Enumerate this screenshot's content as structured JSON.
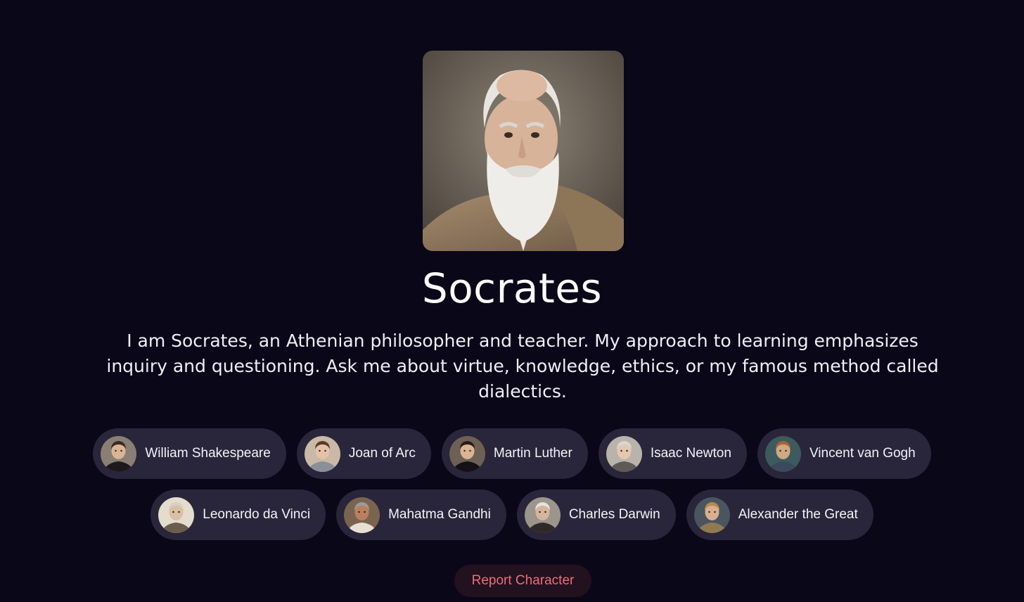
{
  "character": {
    "portrait_icon": "socrates-portrait",
    "name": "Socrates",
    "bio": "I am Socrates, an Athenian philosopher and teacher. My approach to learning emphasizes inquiry and questioning. Ask me about virtue, knowledge, ethics, or my famous method called dialectics."
  },
  "suggested_characters": {
    "rows": [
      [
        {
          "label": "William Shakespeare",
          "skin": "#d9b596",
          "hair": "#3b2a20",
          "bg": "#8a7f75",
          "cloth": "#1c1a1c"
        },
        {
          "label": "Joan of Arc",
          "skin": "#e3c3a8",
          "hair": "#5a3a24",
          "bg": "#c9b9a6",
          "cloth": "#8a8f98"
        },
        {
          "label": "Martin Luther",
          "skin": "#dcb394",
          "hair": "#2a1d16",
          "bg": "#6d6054",
          "cloth": "#141214"
        }
      ],
      [
        {
          "label": "Isaac Newton",
          "skin": "#e4c7b0",
          "hair": "#d8d6d3",
          "bg": "#b9b3ab",
          "cloth": "#5e5a55"
        },
        {
          "label": "Vincent van Gogh",
          "skin": "#d2a784",
          "hair": "#a5662e",
          "bg": "#3d5a5e",
          "cloth": "#3a4a5a"
        }
      ],
      [
        {
          "label": "Leonardo da Vinci",
          "skin": "#d9c0a4",
          "hair": "#d6d0c4",
          "bg": "#e4dccd",
          "cloth": "#6b5d4d"
        },
        {
          "label": "Mahatma Gandhi",
          "skin": "#b98060",
          "hair": "#9b9b96",
          "bg": "#7a6450",
          "cloth": "#e8e1d3"
        },
        {
          "label": "Charles Darwin",
          "skin": "#d6b59c",
          "hair": "#e4e2de",
          "bg": "#9b958c",
          "cloth": "#2e2a28"
        },
        {
          "label": "Alexander the Great",
          "skin": "#d8b090",
          "hair": "#b88a4a",
          "bg": "#4a5560",
          "cloth": "#8f7a52"
        }
      ]
    ]
  },
  "report_button": {
    "label": "Report Character",
    "color": "#ee6d78"
  },
  "colors": {
    "background": "#0a0719",
    "chip": "#29253a",
    "report_bg": "#22111f"
  }
}
